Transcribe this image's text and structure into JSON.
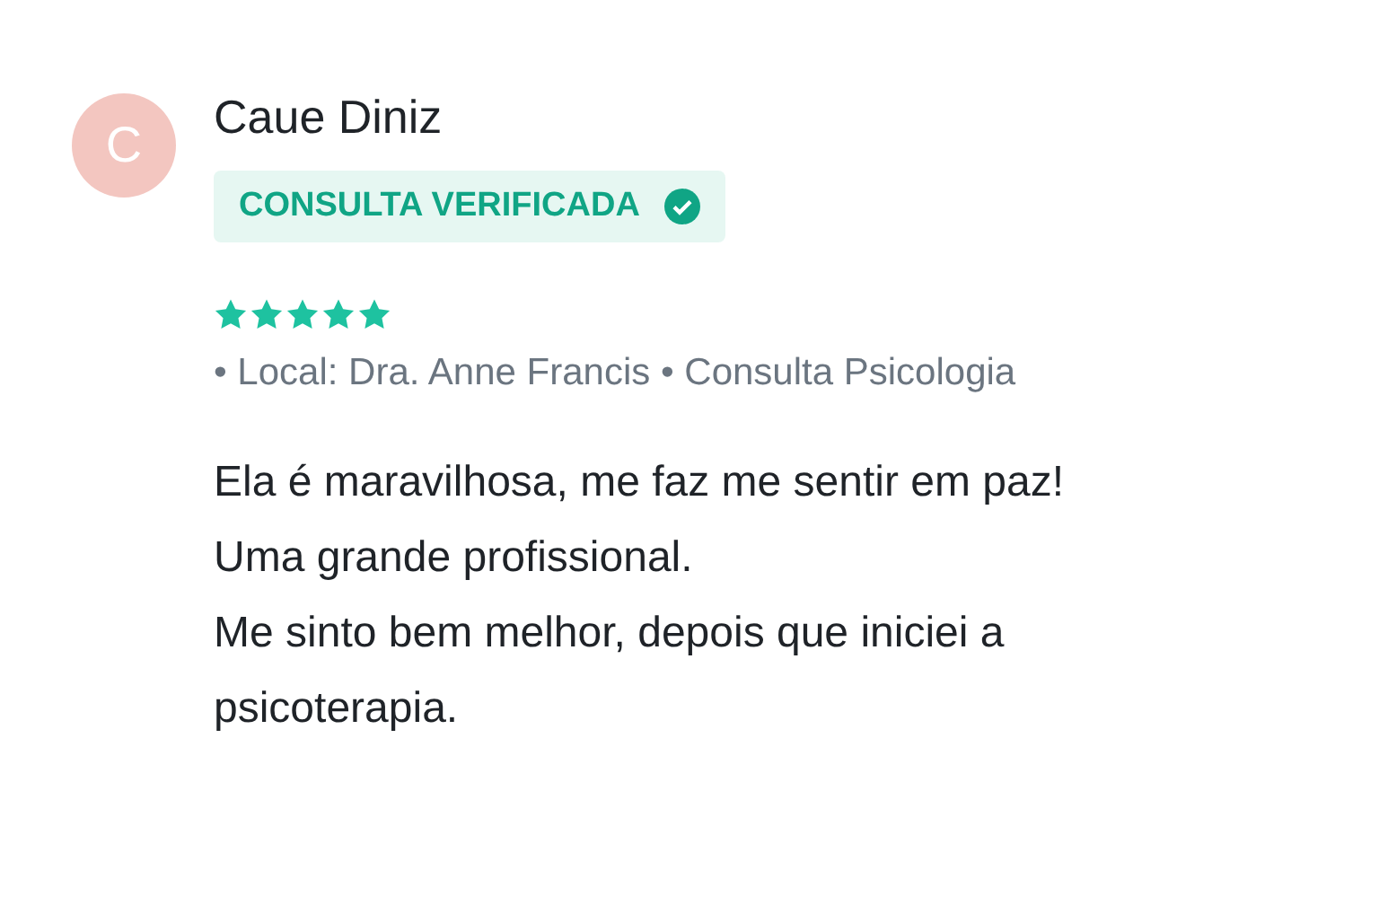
{
  "review": {
    "avatar": {
      "initial": "C",
      "color": "#f3c6c0"
    },
    "author": "Caue Diniz",
    "badge": {
      "label": "CONSULTA VERIFICADA",
      "verified": true
    },
    "stars": 5,
    "meta": "• Local: Dra. Anne Francis • Consulta Psicologia",
    "body": [
      "Ela é maravilhosa, me faz me sentir em paz!",
      "Uma grande profissional.",
      "Me sinto bem melhor, depois que iniciei a psicoterapia."
    ]
  }
}
